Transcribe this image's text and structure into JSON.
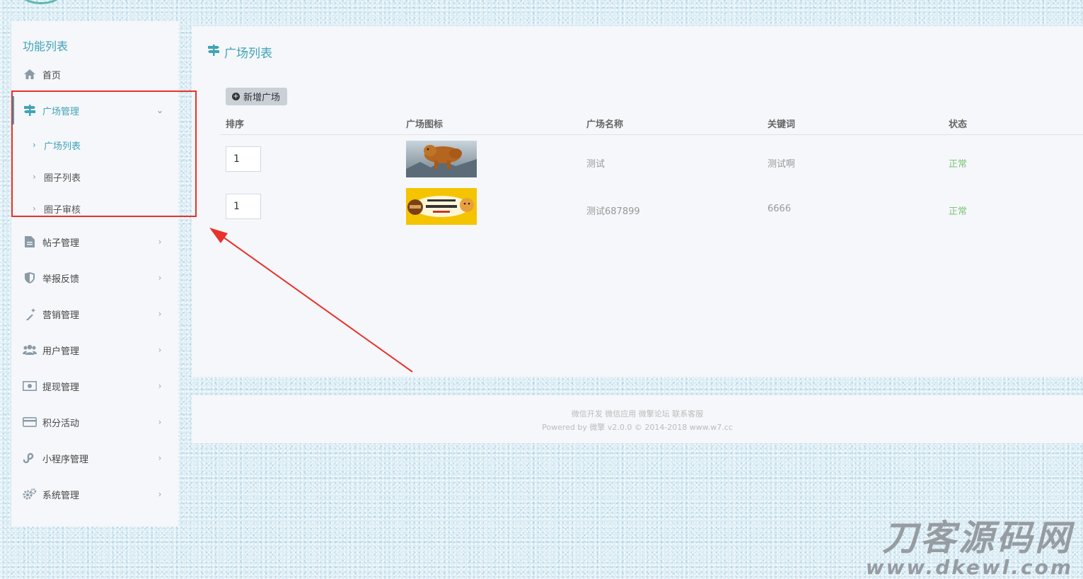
{
  "sidebar": {
    "title": "功能列表",
    "home": "首页",
    "plaza_mgmt": "广场管理",
    "sub": [
      "广场列表",
      "圈子列表",
      "圈子审核"
    ],
    "items": [
      "帖子管理",
      "举报反馈",
      "营销管理",
      "用户管理",
      "提现管理",
      "积分活动",
      "小程序管理",
      "系统管理"
    ]
  },
  "main": {
    "title": "广场列表",
    "add_button": "新增广场",
    "columns": [
      "排序",
      "广场图标",
      "广场名称",
      "关键词",
      "状态"
    ],
    "rows": [
      {
        "sort": "1",
        "name": "测试",
        "keyword": "测试啊",
        "status": "正常"
      },
      {
        "sort": "1",
        "name": "测试687899",
        "keyword": "6666",
        "status": "正常"
      }
    ]
  },
  "footer": {
    "links": "微信开发 微信应用 微擎论坛 联系客服",
    "powered": "Powered by 微擎 v2.0.0 © 2014-2018 www.w7.cc"
  },
  "watermark": {
    "line1": "刀客源码网",
    "line2": "www.dkewl.com"
  },
  "colors": {
    "accent": "#41a3b8",
    "status_ok": "#7cc576",
    "annotation": "#e8322a"
  }
}
